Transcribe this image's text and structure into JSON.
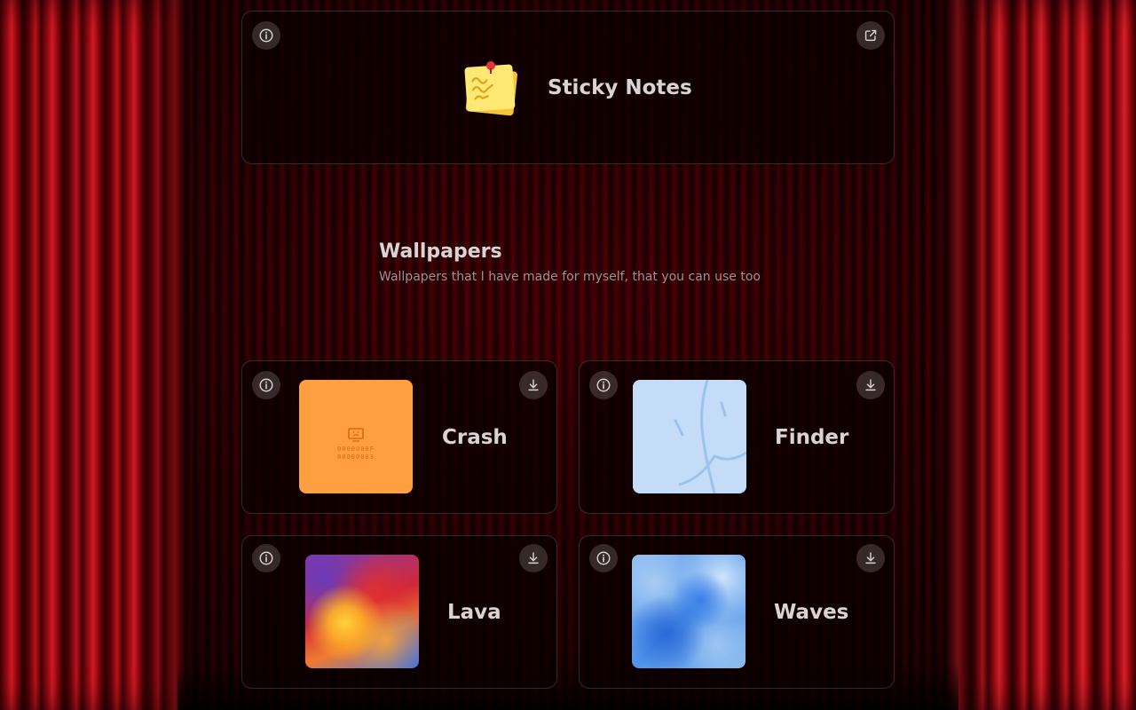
{
  "sticky_notes": {
    "title": "Sticky Notes"
  },
  "section": {
    "title": "Wallpapers",
    "subtitle": "Wallpapers that I have made for myself, that you can use too"
  },
  "wallpapers": [
    {
      "name": "Crash",
      "crash_code_1": "0000000F",
      "crash_code_2": "00000003"
    },
    {
      "name": "Finder"
    },
    {
      "name": "Lava"
    },
    {
      "name": "Waves"
    }
  ],
  "icons": {
    "info": "info-icon",
    "open_external": "external-link-icon",
    "download": "download-icon"
  },
  "colors": {
    "curtain_red": "#c0141e",
    "card_border": "#4a3a3a",
    "crash_orange": "#ff9f40",
    "finder_blue": "#c4dcf7",
    "waves_blue": "#4f94e8"
  }
}
